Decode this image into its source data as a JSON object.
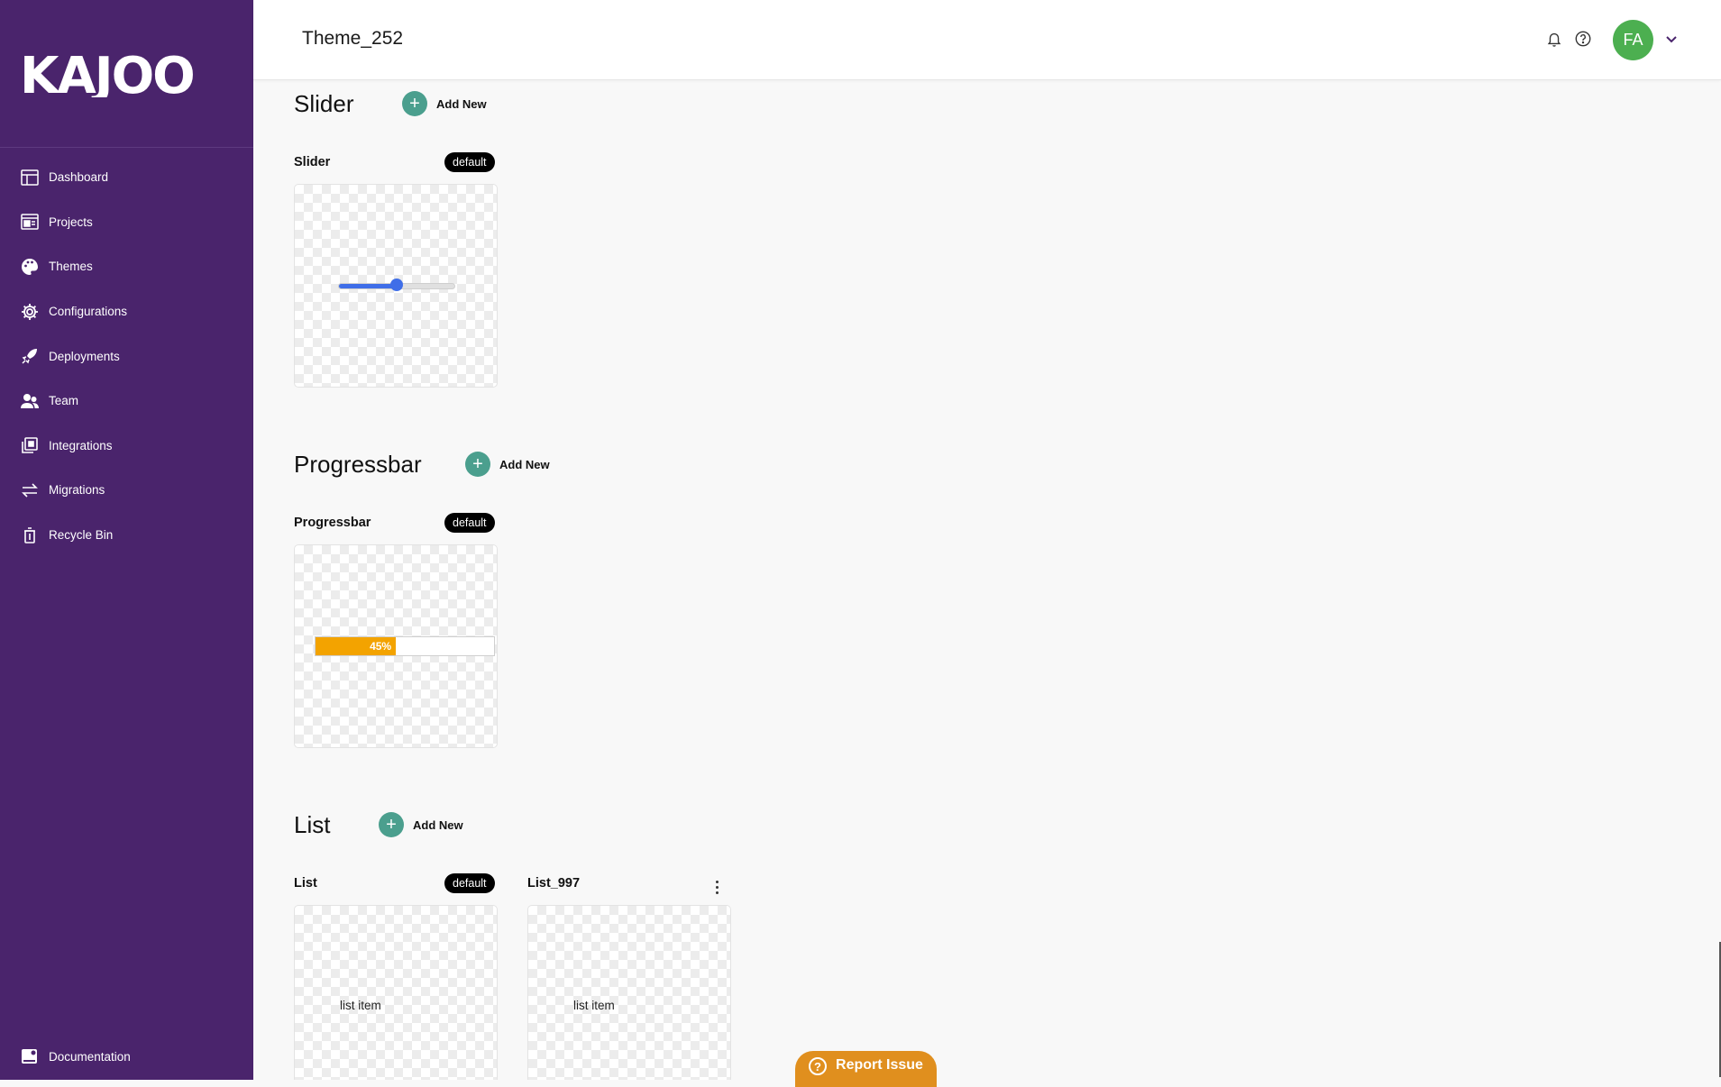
{
  "brand": {
    "logo_text": "KAJOO"
  },
  "sidebar": {
    "items": [
      {
        "label": "Dashboard",
        "icon": "dashboard-icon"
      },
      {
        "label": "Projects",
        "icon": "projects-icon"
      },
      {
        "label": "Themes",
        "icon": "palette-icon"
      },
      {
        "label": "Configurations",
        "icon": "gear-icon"
      },
      {
        "label": "Deployments",
        "icon": "rocket-icon"
      },
      {
        "label": "Team",
        "icon": "team-icon"
      },
      {
        "label": "Integrations",
        "icon": "integrations-icon"
      },
      {
        "label": "Migrations",
        "icon": "arrows-icon"
      },
      {
        "label": "Recycle Bin",
        "icon": "trash-icon"
      }
    ],
    "documentation": {
      "label": "Documentation",
      "icon": "book-icon"
    }
  },
  "header": {
    "title": "Theme_252",
    "avatar_initials": "FA"
  },
  "sections": {
    "slider": {
      "title": "Slider",
      "add_label": "Add New",
      "cards": [
        {
          "title": "Slider",
          "badge": "default",
          "value_fraction": 0.5
        }
      ]
    },
    "progressbar": {
      "title": "Progressbar",
      "add_label": "Add New",
      "cards": [
        {
          "title": "Progressbar",
          "badge": "default",
          "progress_text": "45%",
          "progress_fraction": 0.45
        }
      ]
    },
    "list": {
      "title": "List",
      "add_label": "Add New",
      "cards": [
        {
          "title": "List",
          "badge": "default",
          "item_text": "list item"
        },
        {
          "title": "List_997",
          "item_text": "list item"
        }
      ]
    }
  },
  "report_issue": {
    "label": "Report Issue"
  },
  "colors": {
    "sidebar_bg": "#4a246c",
    "add_button": "#4b9f8e",
    "slider": "#3f6ee8",
    "progress": "#f3a300",
    "avatar": "#4caf50",
    "report": "#e08f1e"
  }
}
